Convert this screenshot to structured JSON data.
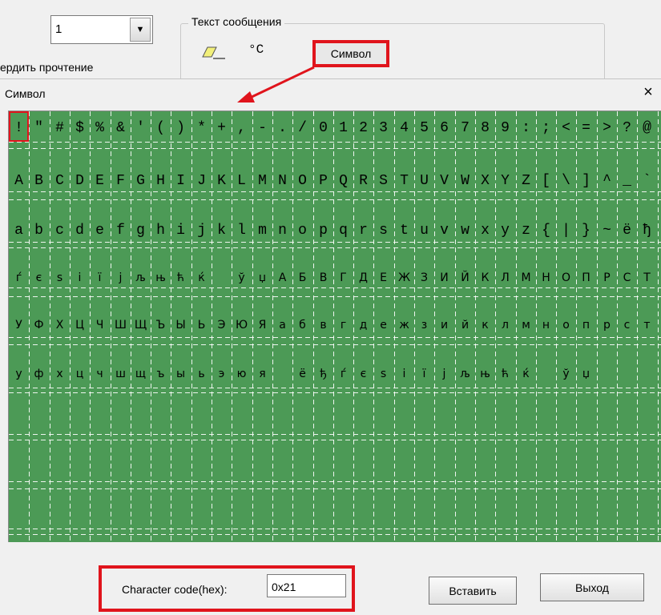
{
  "top": {
    "select_value": "1",
    "confirm_label": "ердить прочтение",
    "group_title": "Текст сообщения",
    "degc_label": "°C",
    "symbol_button": "Символ"
  },
  "dialog": {
    "title": "Символ",
    "close_label": "×",
    "rows": [
      [
        "!",
        "\"",
        "#",
        "$",
        "%",
        "&",
        "'",
        "(",
        ")",
        "*",
        "+",
        ",",
        "-",
        ".",
        "/",
        "0",
        "1",
        "2",
        "3",
        "4",
        "5",
        "6",
        "7",
        "8",
        "9",
        ":",
        ";",
        "<",
        "=",
        ">",
        "?",
        "@"
      ],
      [
        "A",
        "B",
        "C",
        "D",
        "E",
        "F",
        "G",
        "H",
        "I",
        "J",
        "K",
        "L",
        "M",
        "N",
        "O",
        "P",
        "Q",
        "R",
        "S",
        "T",
        "U",
        "V",
        "W",
        "X",
        "Y",
        "Z",
        "[",
        "\\",
        "]",
        "^",
        "_",
        "`"
      ],
      [
        "a",
        "b",
        "c",
        "d",
        "e",
        "f",
        "g",
        "h",
        "i",
        "j",
        "k",
        "l",
        "m",
        "n",
        "o",
        "p",
        "q",
        "r",
        "s",
        "t",
        "u",
        "v",
        "w",
        "x",
        "y",
        "z",
        "{",
        "|",
        "}",
        "~",
        "ё",
        "ђ"
      ],
      [
        "ѓ",
        "є",
        "ѕ",
        "і",
        "ї",
        "ј",
        "љ",
        "њ",
        "ћ",
        "ќ",
        "",
        "ў",
        "џ",
        "А",
        "Б",
        "В",
        "Г",
        "Д",
        "Е",
        "Ж",
        "З",
        "И",
        "Й",
        "К",
        "Л",
        "М",
        "Н",
        "О",
        "П",
        "Р",
        "С",
        "Т"
      ],
      [
        "У",
        "Ф",
        "Х",
        "Ц",
        "Ч",
        "Ш",
        "Щ",
        "Ъ",
        "Ы",
        "Ь",
        "Э",
        "Ю",
        "Я",
        "а",
        "б",
        "в",
        "г",
        "д",
        "е",
        "ж",
        "з",
        "и",
        "й",
        "к",
        "л",
        "м",
        "н",
        "о",
        "п",
        "р",
        "с",
        "т"
      ],
      [
        "у",
        "ф",
        "х",
        "ц",
        "ч",
        "ш",
        "щ",
        "ъ",
        "ы",
        "ь",
        "э",
        "ю",
        "я",
        "",
        "ё",
        "ђ",
        "ѓ",
        "є",
        "ѕ",
        "і",
        "ї",
        "ј",
        "љ",
        "њ",
        "ћ",
        "ќ",
        "",
        "ў",
        "џ",
        "",
        "",
        ""
      ]
    ],
    "code_label": "Character code(hex):",
    "code_value": "0x21",
    "insert_button": "Вставить",
    "exit_button": "Выход"
  },
  "colors": {
    "grid_background": "#4c9a56",
    "highlight": "#e0141c"
  },
  "icons": [
    "chevron-down-icon",
    "eraser-icon",
    "close-icon"
  ]
}
